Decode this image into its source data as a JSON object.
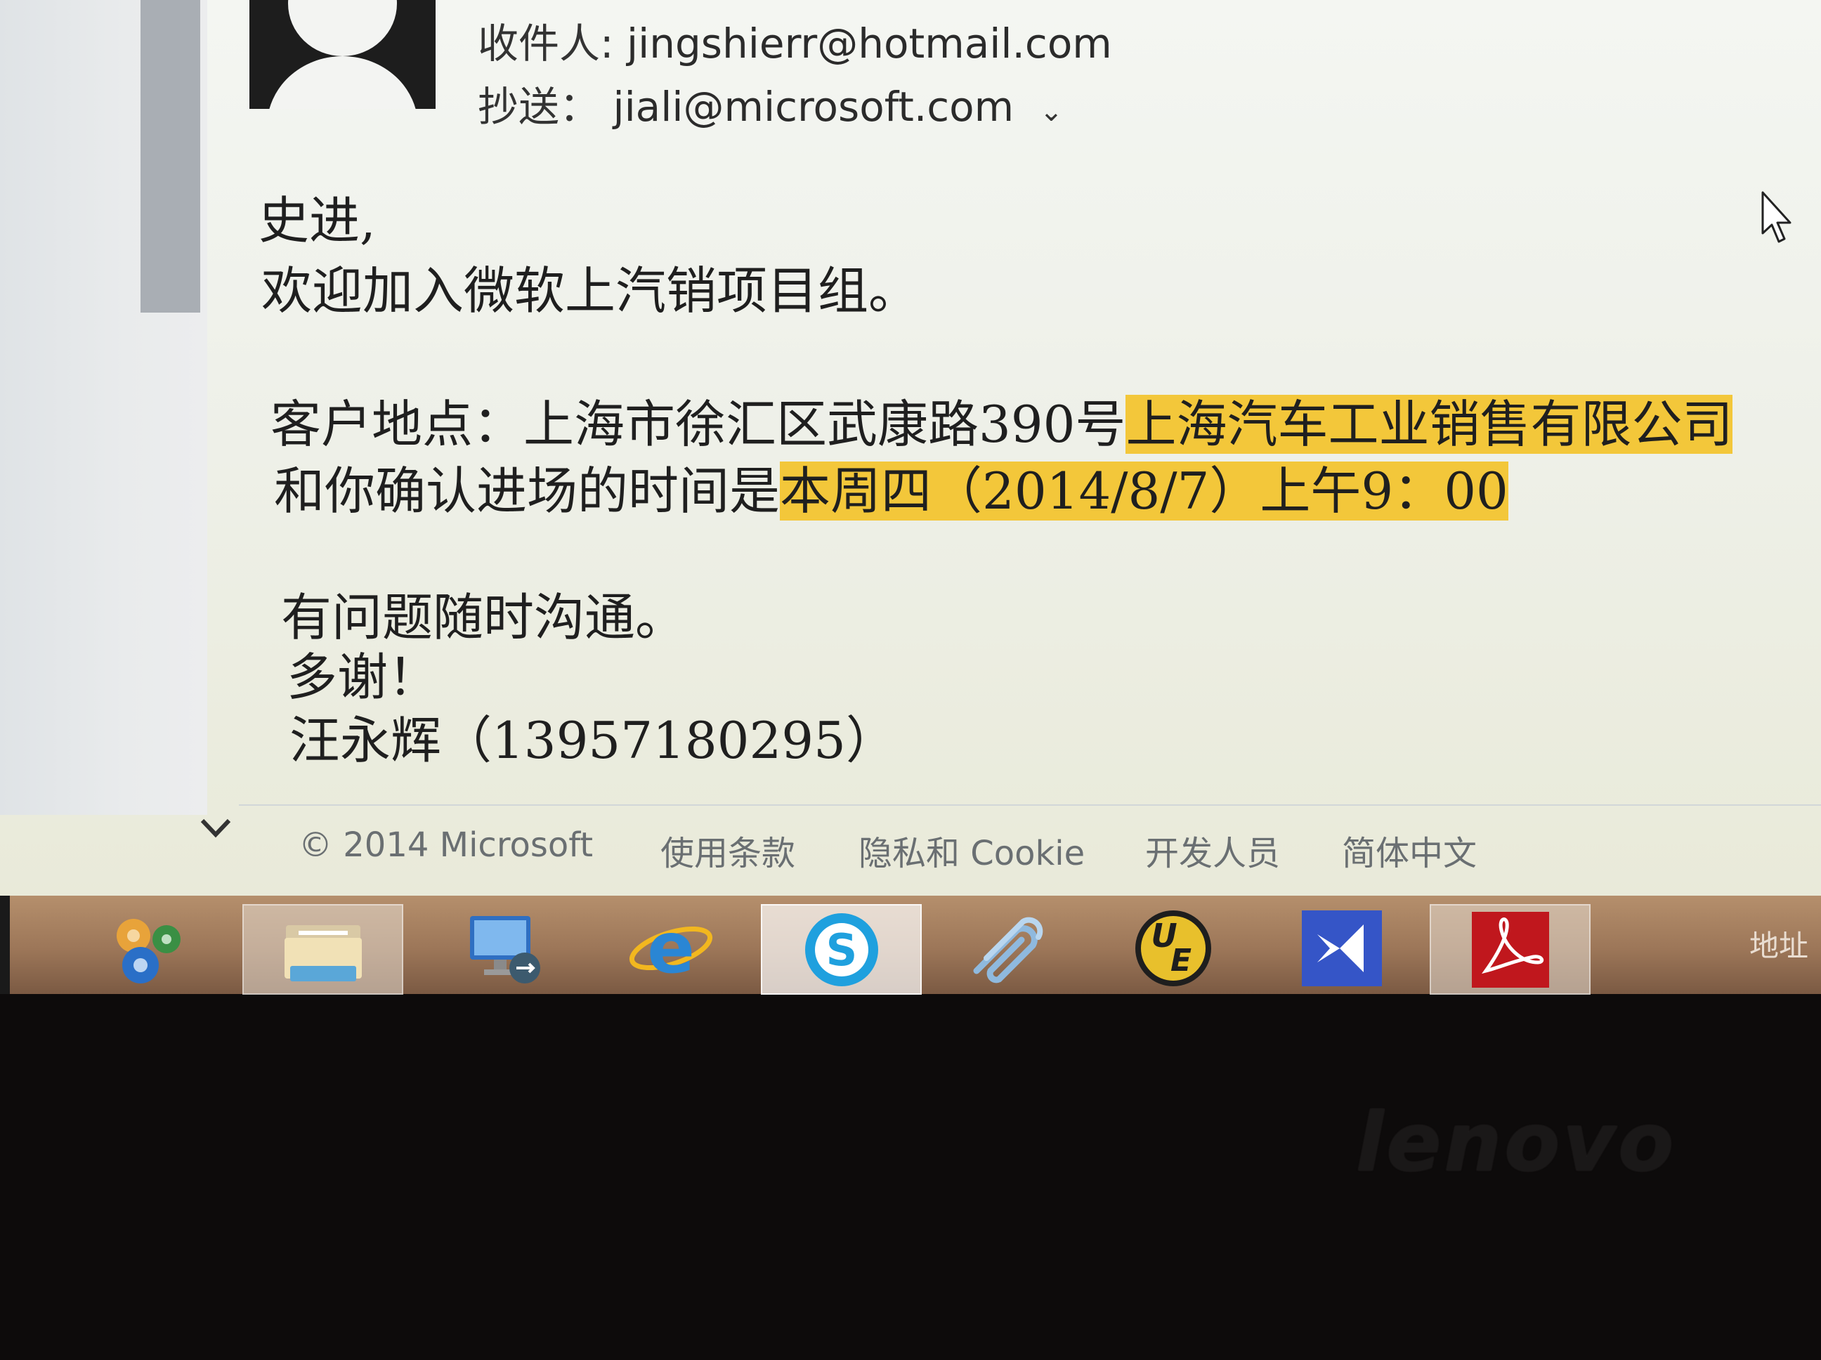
{
  "email": {
    "to_label": "收件人:",
    "to_value": "jingshierr@hotmail.com",
    "cc_label": "抄送：",
    "cc_value": "jiali@microsoft.com",
    "greeting": "史进,",
    "welcome": "欢迎加入微软上汽销项目组。",
    "address_prefix": "客户地点：上海市徐汇区武康路390号",
    "address_highlight": "上海汽车工业销售有限公司",
    "time_prefix": "和你确认进场的时间是",
    "time_highlight": "本周四（2014/8/7）上午9：00",
    "ask": "有问题随时沟通。",
    "thanks": "多谢！",
    "signature": "汪永辉（13957180295）"
  },
  "footer": {
    "copyright": "© 2014 Microsoft",
    "terms": "使用条款",
    "privacy": "隐私和 Cookie",
    "developers": "开发人员",
    "language": "简体中文"
  },
  "taskbar": {
    "items": [
      "settings-gears",
      "file-explorer",
      "remote-desktop",
      "internet-explorer",
      "skype",
      "paperclip-app",
      "ultraedit",
      "visual-studio",
      "adobe-reader"
    ],
    "address_label": "地址"
  },
  "bezel": {
    "brand": "lenovo"
  },
  "colors": {
    "highlight": "#f3c73a",
    "taskbar": "#9c7658"
  }
}
